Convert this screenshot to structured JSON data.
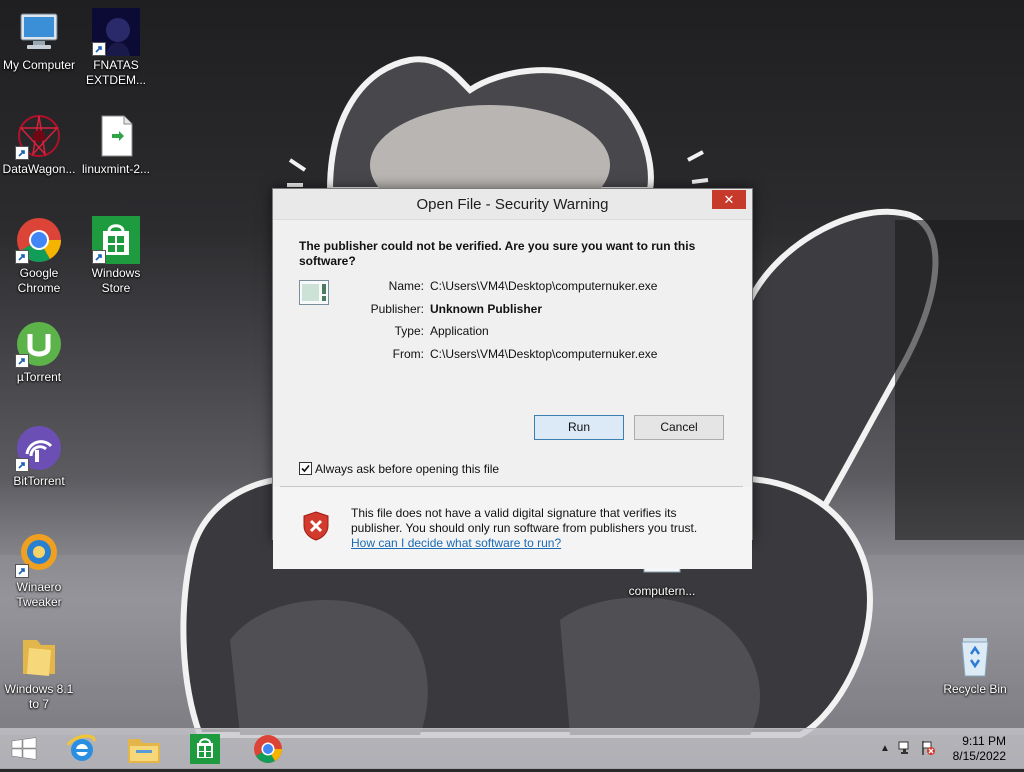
{
  "desktop": {
    "icons": [
      {
        "label": "My Computer",
        "icon": "computer-icon"
      },
      {
        "label": "FNATAS EXTDEM...",
        "icon": "fnatas-icon"
      },
      {
        "label": "DataWagon...",
        "icon": "datawagon-icon"
      },
      {
        "label": "linuxmint-2...",
        "icon": "file-icon"
      },
      {
        "label": "Google Chrome",
        "icon": "chrome-icon"
      },
      {
        "label": "Windows Store",
        "icon": "windows-store-icon"
      },
      {
        "label": "µTorrent",
        "icon": "utorrent-icon"
      },
      {
        "label": "BitTorrent",
        "icon": "bittorrent-icon"
      },
      {
        "label": "Winaero Tweaker",
        "icon": "winaero-icon"
      },
      {
        "label": "Windows 8.1 to 7",
        "icon": "folder-icon"
      },
      {
        "label": "computern...",
        "icon": "exe-file-icon"
      },
      {
        "label": "Recycle Bin",
        "icon": "recycle-bin-icon"
      }
    ]
  },
  "dialog": {
    "title": "Open File - Security Warning",
    "close_label": "✕",
    "question": "The publisher could not be verified.  Are you sure you want to run this software?",
    "props": [
      {
        "key": "Name:",
        "value": "C:\\Users\\VM4\\Desktop\\computernuker.exe"
      },
      {
        "key": "Publisher:",
        "value": "Unknown Publisher"
      },
      {
        "key": "Type:",
        "value": "Application"
      },
      {
        "key": "From:",
        "value": "C:\\Users\\VM4\\Desktop\\computernuker.exe"
      }
    ],
    "run_label": "Run",
    "cancel_label": "Cancel",
    "checkbox_label": "Always ask before opening this file",
    "checkbox_checked": true,
    "footer_text": "This file does not have a valid digital signature that verifies its publisher.  You should only run software from publishers you trust.",
    "footer_link": "How can I decide what software to run?"
  },
  "taskbar": {
    "pinned": [
      "start-button",
      "internet-explorer-icon",
      "file-explorer-icon",
      "windows-store-icon",
      "chrome-icon"
    ],
    "time": "9:11 PM",
    "date": "8/15/2022"
  }
}
